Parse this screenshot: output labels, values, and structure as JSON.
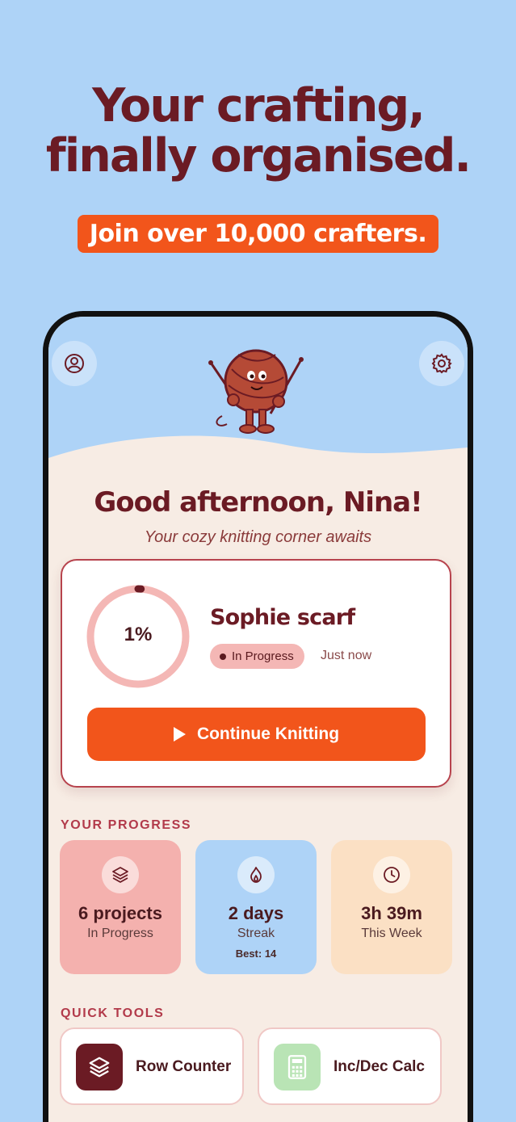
{
  "promo": {
    "headline_line1": "Your crafting,",
    "headline_line2": "finally organised.",
    "tagline": "Join over 10,000 crafters."
  },
  "app": {
    "header": {
      "profile_icon": "person-circle-icon",
      "settings_icon": "gear-icon",
      "mascot": "yarn-ball-mascot"
    },
    "greeting": "Good afternoon, Nina!",
    "subgreeting": "Your cozy knitting corner awaits",
    "current_project": {
      "progress_label": "1%",
      "progress_fraction": 0.01,
      "name": "Sophie scarf",
      "status": "In Progress",
      "updated": "Just now",
      "continue_label": "Continue Knitting"
    },
    "progress_section": {
      "title": "YOUR PROGRESS",
      "stats": [
        {
          "icon": "layers-icon",
          "value": "6 projects",
          "label": "In Progress",
          "sub": ""
        },
        {
          "icon": "flame-icon",
          "value": "2 days",
          "label": "Streak",
          "sub": "Best: 14"
        },
        {
          "icon": "clock-icon",
          "value": "3h 39m",
          "label": "This Week",
          "sub": ""
        }
      ]
    },
    "tools_section": {
      "title": "QUICK TOOLS",
      "tools": [
        {
          "icon": "layers-icon",
          "label": "Row Counter"
        },
        {
          "icon": "calculator-icon",
          "label": "Inc/Dec Calc"
        }
      ]
    }
  },
  "colors": {
    "background": "#aed3f7",
    "brand_dark": "#6b1b24",
    "accent": "#f2551b",
    "card_pink": "#f4b1ae",
    "card_blue": "#aed3f7",
    "card_peach": "#fbe0c4"
  }
}
